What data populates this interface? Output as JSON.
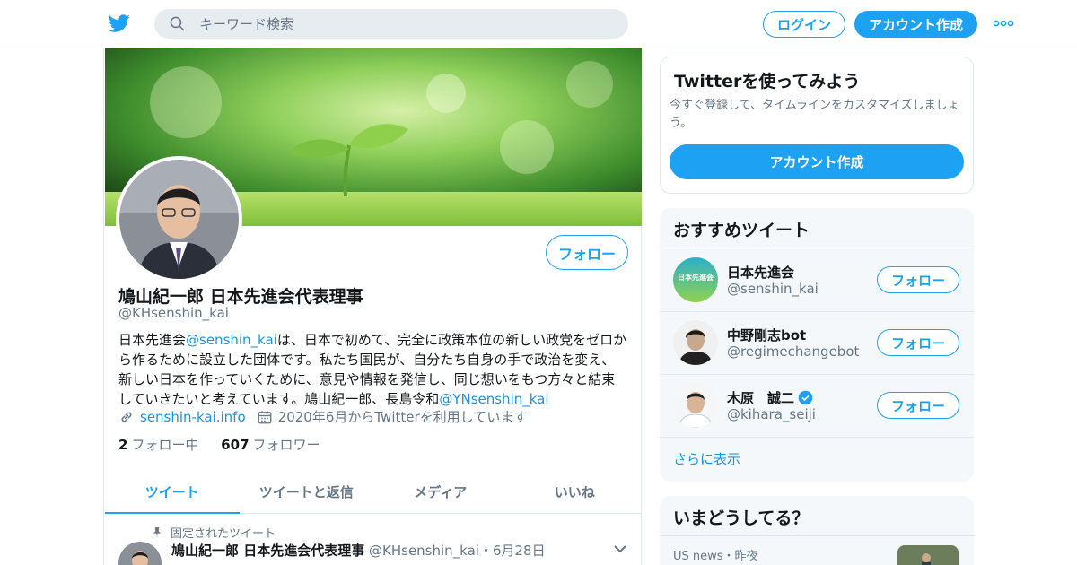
{
  "search": {
    "placeholder": "キーワード検索"
  },
  "header": {
    "login_label": "ログイン",
    "signup_label": "アカウント作成"
  },
  "profile": {
    "name": "鳩山紀一郎 日本先進会代表理事",
    "handle": "@KHsenshin_kai",
    "follow_label": "フォロー",
    "bio": {
      "part1": "日本先進会",
      "mention1": "@senshin_kai",
      "part2": "は、日本で初めて、完全に政策本位の新しい政党をゼロから作るために設立した団体です。私たち国民が、自分たち自身の手で政治を変え、新しい日本を作っていくために、意見や情報を発信し、同じ想いをもつ方々と結束していきたいと考えています。鳩山紀一郎、長島令和",
      "mention2": "@YNsenshin_kai"
    },
    "website": "senshin-kai.info",
    "joined": "2020年6月からTwitterを利用しています",
    "following_count": "2",
    "following_label": "フォロー中",
    "followers_count": "607",
    "followers_label": "フォロワー"
  },
  "tabs": [
    {
      "label": "ツイート",
      "active": true
    },
    {
      "label": "ツイートと返信",
      "active": false
    },
    {
      "label": "メディア",
      "active": false
    },
    {
      "label": "いいね",
      "active": false
    }
  ],
  "pinned_tweet": {
    "pinned_label": "固定されたツイート",
    "author": "鳩山紀一郎 日本先進会代表理事",
    "handle_date": "@KHsenshin_kai・6月28日"
  },
  "signup_card": {
    "title": "Twitterを使ってみよう",
    "text": "今すぐ登録して、タイムラインをカスタマイズしましょう。",
    "button_label": "アカウント作成"
  },
  "recommended": {
    "title": "おすすめツイート",
    "items": [
      {
        "name": "日本先進会",
        "handle": "@senshin_kai",
        "avatar_text": "日本先進会",
        "verified": false,
        "follow_label": "フォロー"
      },
      {
        "name": "中野剛志bot",
        "handle": "@regimechangebot",
        "verified": false,
        "follow_label": "フォロー"
      },
      {
        "name": "木原　誠二",
        "handle": "@kihara_seiji",
        "verified": true,
        "follow_label": "フォロー"
      }
    ],
    "show_more": "さらに表示"
  },
  "trends": {
    "title": "いまどうしてる？",
    "meta": "US news・昨夜"
  },
  "colors": {
    "accent": "#1da1f2",
    "text_secondary": "#657786",
    "border": "#e1e8ed"
  }
}
